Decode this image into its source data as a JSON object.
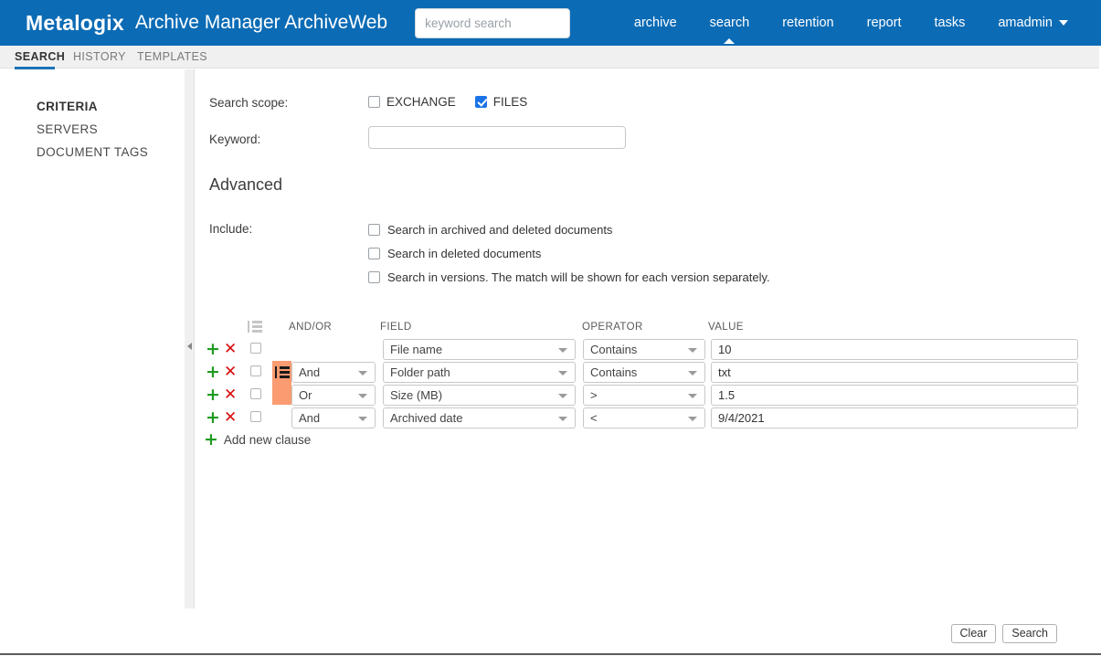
{
  "header": {
    "brand": "Metalogix",
    "app_title": "Archive Manager ArchiveWeb",
    "search_placeholder": "keyword search",
    "nav": [
      {
        "label": "archive",
        "active": false
      },
      {
        "label": "search",
        "active": true
      },
      {
        "label": "retention",
        "active": false
      },
      {
        "label": "report",
        "active": false
      },
      {
        "label": "tasks",
        "active": false
      },
      {
        "label": "amadmin",
        "active": false,
        "has_caret": true
      }
    ],
    "accent_color": "#0b6bb5"
  },
  "tabs": [
    {
      "label": "SEARCH",
      "active": true
    },
    {
      "label": "HISTORY",
      "active": false
    },
    {
      "label": "TEMPLATES",
      "active": false
    }
  ],
  "sidebar": {
    "items": [
      {
        "label": "CRITERIA",
        "active": true
      },
      {
        "label": "SERVERS",
        "active": false
      },
      {
        "label": "DOCUMENT TAGS",
        "active": false
      }
    ]
  },
  "main": {
    "scope_label": "Search scope:",
    "scope_options": [
      {
        "label": "EXCHANGE",
        "checked": false
      },
      {
        "label": "FILES",
        "checked": true
      }
    ],
    "keyword_label": "Keyword:",
    "keyword_value": "",
    "keyword_placeholder": "",
    "advanced_title": "Advanced",
    "include_label": "Include:",
    "include_options": [
      {
        "label": "Search in archived and deleted documents",
        "checked": false
      },
      {
        "label": "Search in deleted documents",
        "checked": false
      },
      {
        "label": "Search in versions. The match will be shown for each version separately.",
        "checked": false
      }
    ]
  },
  "criteria": {
    "headers": {
      "group_icon": "group-list-icon",
      "andor": "AND/OR",
      "field": "FIELD",
      "operator": "OPERATOR",
      "value": "VALUE"
    },
    "grouping_highlight_color": "#fb9b72",
    "add_icon": "plus-icon",
    "remove_icon": "close-x-icon",
    "rows": [
      {
        "andor": "",
        "has_andor": false,
        "field": "File name",
        "operator": "Contains",
        "value": "10",
        "selected": false
      },
      {
        "andor": "And",
        "has_andor": true,
        "field": "Folder path",
        "operator": "Contains",
        "value": "txt",
        "selected": false
      },
      {
        "andor": "Or",
        "has_andor": true,
        "field": "Size (MB)",
        "operator": ">",
        "value": "1.5",
        "selected": false
      },
      {
        "andor": "And",
        "has_andor": true,
        "field": "Archived date",
        "operator": "<",
        "value": "9/4/2021",
        "selected": false
      }
    ],
    "add_clause_label": "Add new clause"
  },
  "footer": {
    "clear_label": "Clear",
    "search_label": "Search"
  }
}
